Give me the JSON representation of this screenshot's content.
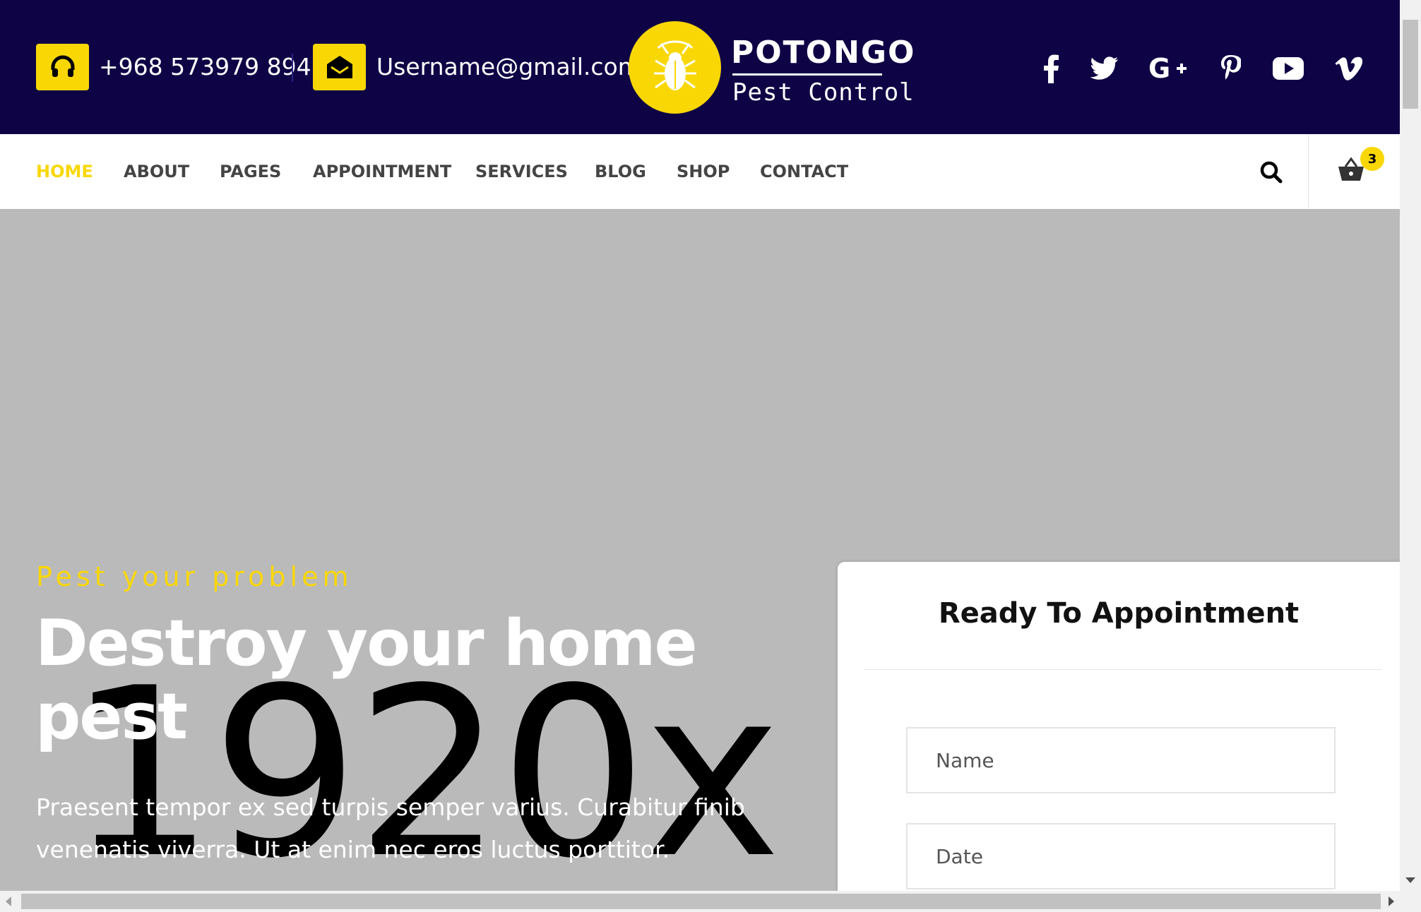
{
  "header": {
    "phone": "+968 573979 894",
    "email": "Username@gmail.com",
    "logo": {
      "title": "POTONGO",
      "subtitle": "Pest Control"
    },
    "social_icons": [
      "facebook-icon",
      "twitter-icon",
      "google-plus-icon",
      "pinterest-icon",
      "youtube-icon",
      "vimeo-icon"
    ]
  },
  "nav": {
    "items": [
      {
        "label": "HOME",
        "active": true
      },
      {
        "label": "ABOUT"
      },
      {
        "label": "PAGES"
      },
      {
        "label": "APPOINTMENT"
      },
      {
        "label": "SERVICES"
      },
      {
        "label": "BLOG"
      },
      {
        "label": "SHOP"
      },
      {
        "label": "CONTACT"
      }
    ],
    "cart_count": "3"
  },
  "hero": {
    "placeholder": "1920x",
    "kicker": "Pest your problem",
    "title": "Destroy your home pest",
    "description": "Praesent tempor ex sed turpis semper varius. Curabitur finib venenatis viverra. Ut at enim nec eros luctus porttitor."
  },
  "appointment": {
    "title": "Ready To Appointment",
    "name_placeholder": "Name",
    "date_placeholder": "Date"
  },
  "colors": {
    "navy": "#0e0345",
    "accent": "#f9d705",
    "hero_bg": "#bababa"
  }
}
